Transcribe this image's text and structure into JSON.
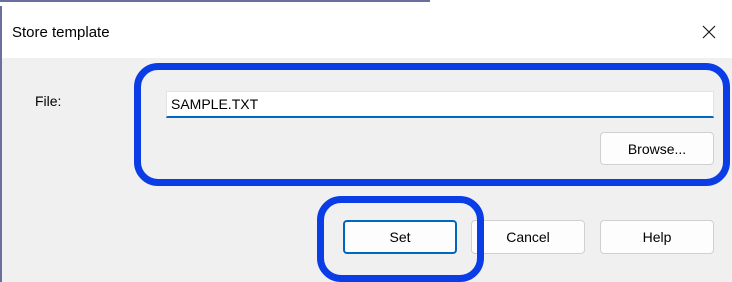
{
  "dialog": {
    "title": "Store template",
    "close_icon": "close-icon"
  },
  "file": {
    "label": "File:",
    "value": "SAMPLE.TXT",
    "placeholder": ""
  },
  "buttons": {
    "browse": "Browse...",
    "set": "Set",
    "cancel": "Cancel",
    "help": "Help"
  },
  "colors": {
    "accent": "#0067c0",
    "highlight": "#0a3de6",
    "window_bg": "#f0f0f0",
    "titlebar_bg": "#ffffff"
  }
}
